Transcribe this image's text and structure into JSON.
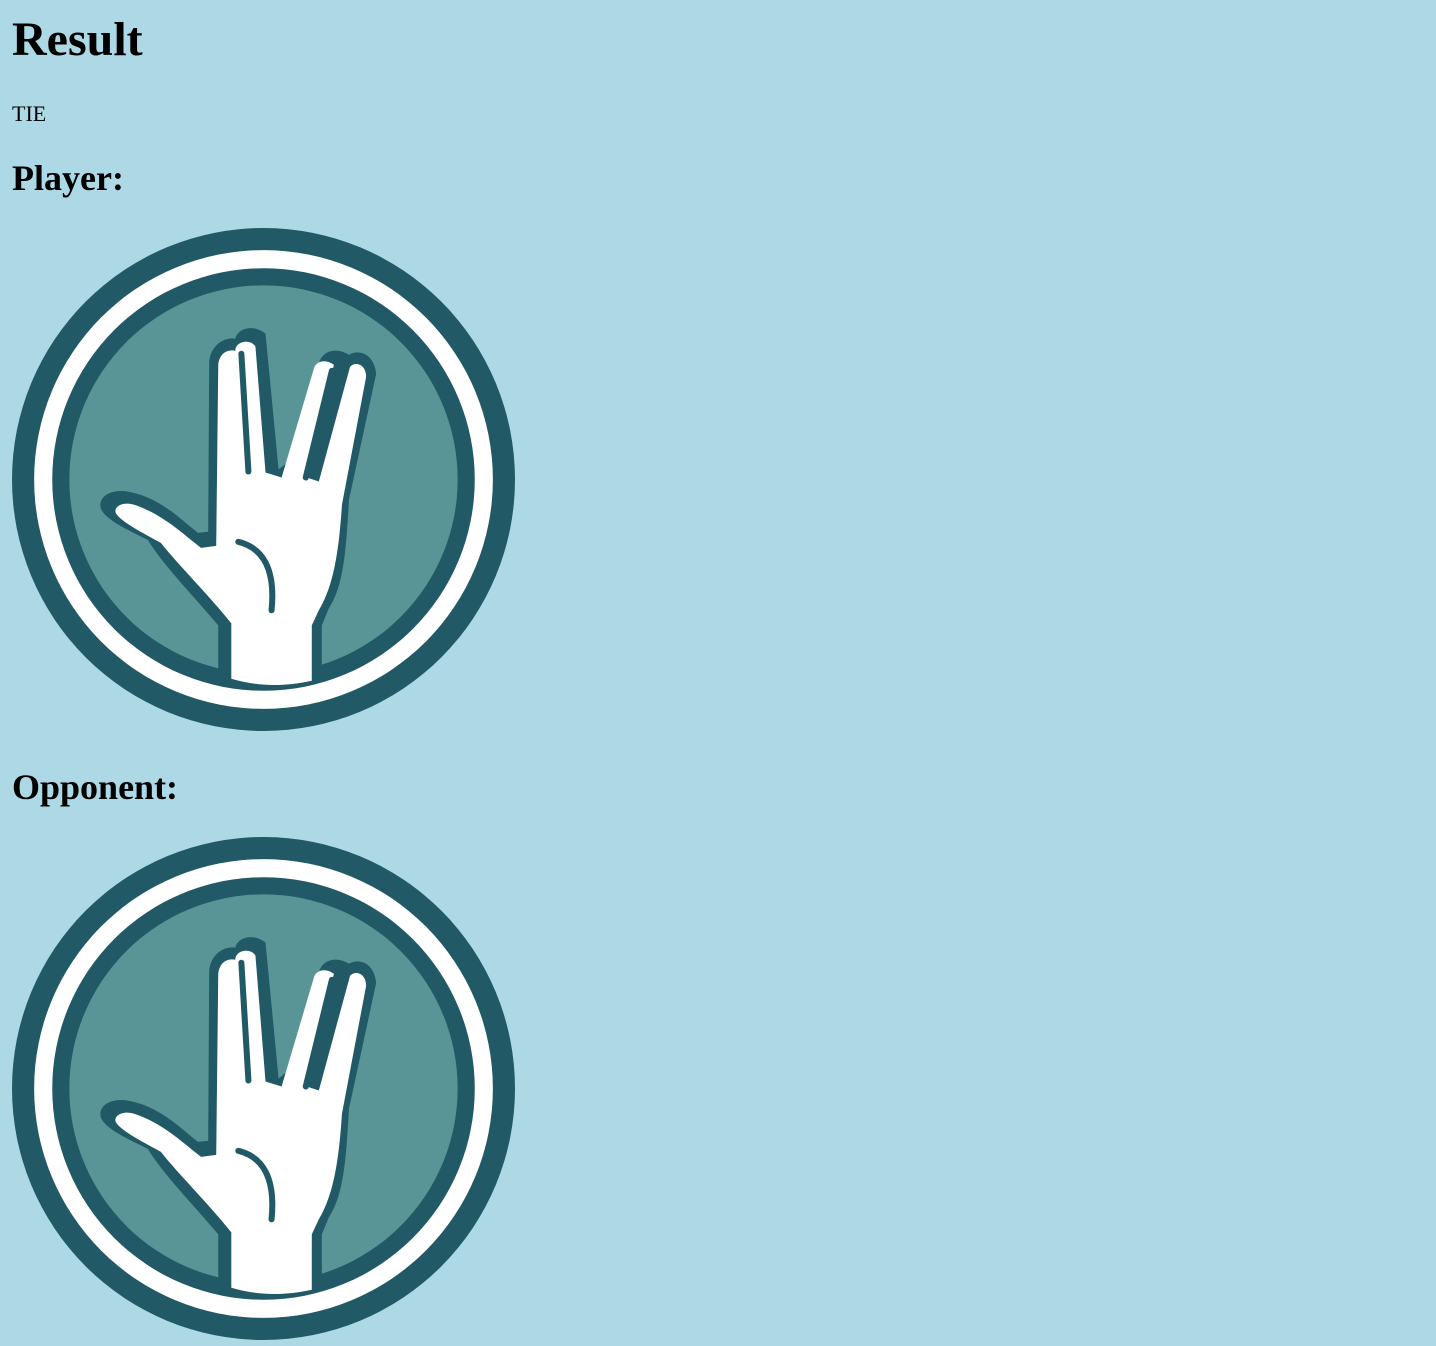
{
  "result": {
    "title": "Result",
    "outcome": "TIE"
  },
  "player": {
    "label": "Player:",
    "choice_icon": "spock-hand-icon"
  },
  "opponent": {
    "label": "Opponent:",
    "choice_icon": "spock-hand-icon"
  },
  "colors": {
    "background": "#add8e6",
    "icon_dark": "#215a66",
    "icon_fill": "#599596",
    "icon_white": "#ffffff"
  }
}
